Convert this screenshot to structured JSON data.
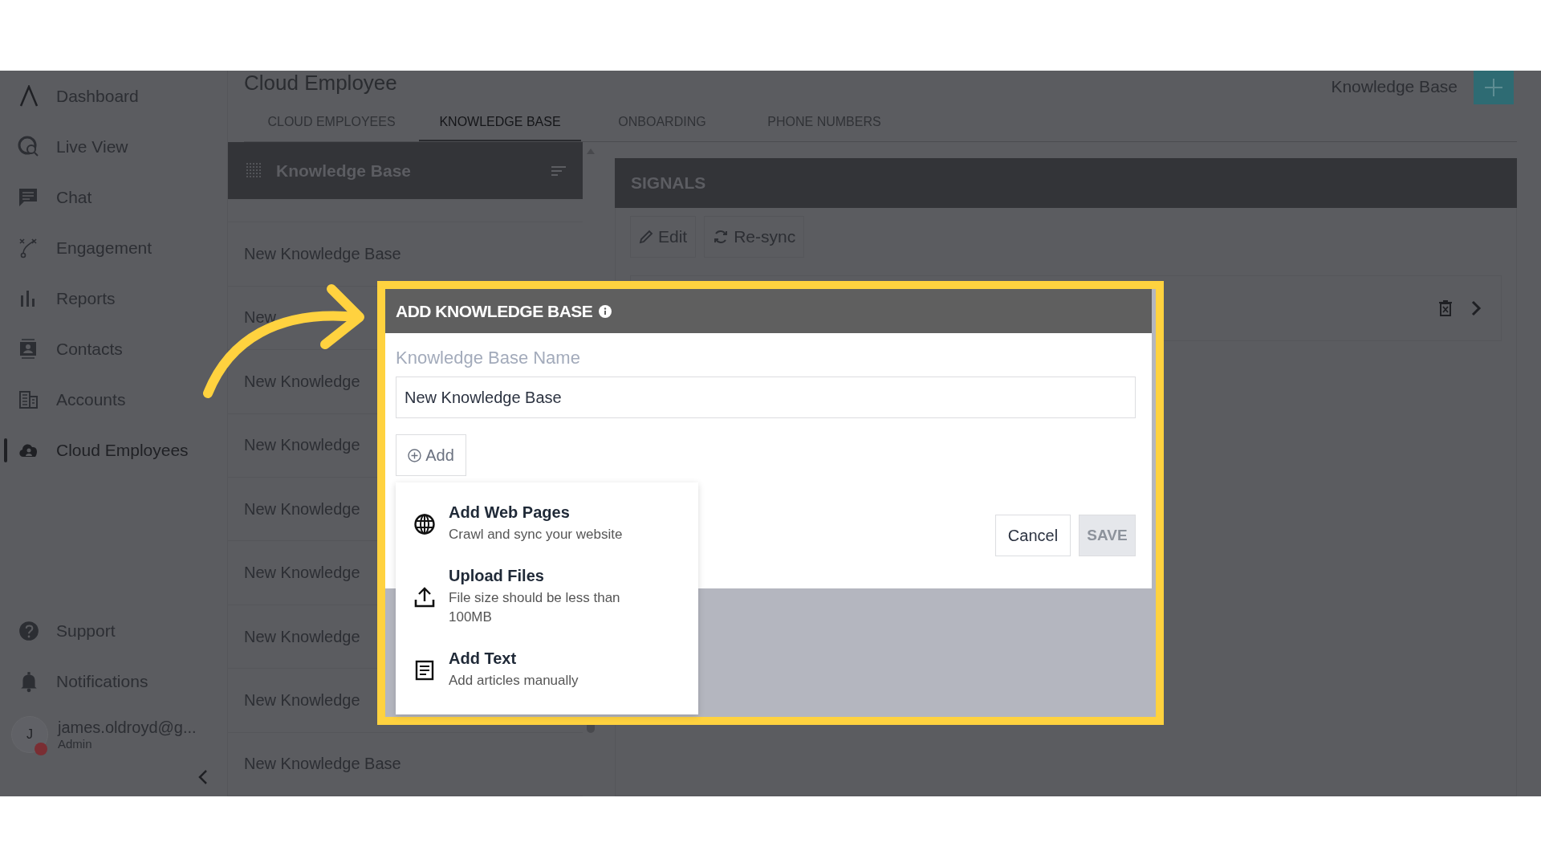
{
  "sidebar": {
    "items": [
      {
        "label": "Dashboard",
        "selected": false
      },
      {
        "label": "Live View",
        "selected": false
      },
      {
        "label": "Chat",
        "selected": false
      },
      {
        "label": "Engagement",
        "selected": false
      },
      {
        "label": "Reports",
        "selected": false
      },
      {
        "label": "Contacts",
        "selected": false
      },
      {
        "label": "Accounts",
        "selected": false
      },
      {
        "label": "Cloud Employees",
        "selected": true
      }
    ],
    "footer_items": [
      {
        "label": "Support"
      },
      {
        "label": "Notifications"
      }
    ],
    "user": {
      "initial": "J",
      "name": "james.oldroyd@g...",
      "role": "Admin"
    }
  },
  "page": {
    "title": "Cloud Employee",
    "header_link": "Knowledge Base",
    "tabs": [
      {
        "label": "CLOUD EMPLOYEES",
        "selected": false
      },
      {
        "label": "KNOWLEDGE BASE",
        "selected": true
      },
      {
        "label": "ONBOARDING",
        "selected": false
      },
      {
        "label": "PHONE NUMBERS",
        "selected": false
      }
    ]
  },
  "knowledge_list": {
    "title": "Knowledge Base",
    "items": [
      "New Knowledge Base",
      "New",
      "New Knowledge",
      "New Knowledge",
      "New Knowledge",
      "New Knowledge",
      "New Knowledge",
      "New Knowledge",
      "New Knowledge Base"
    ]
  },
  "signals": {
    "title": "SIGNALS",
    "buttons": [
      "Edit",
      "Re-sync"
    ]
  },
  "dialog": {
    "title": "ADD KNOWLEDGE BASE",
    "field_label": "Knowledge Base Name",
    "field_value": "New Knowledge Base",
    "add_button": "Add",
    "cancel": "Cancel",
    "save": {
      "label": "SAVE",
      "disabled": true
    },
    "menu": [
      {
        "title": "Add Web Pages",
        "description": "Crawl and sync your website"
      },
      {
        "title": "Upload Files",
        "description": "File size should be less than 100MB"
      },
      {
        "title": "Add Text",
        "description": "Add articles manually"
      }
    ]
  }
}
